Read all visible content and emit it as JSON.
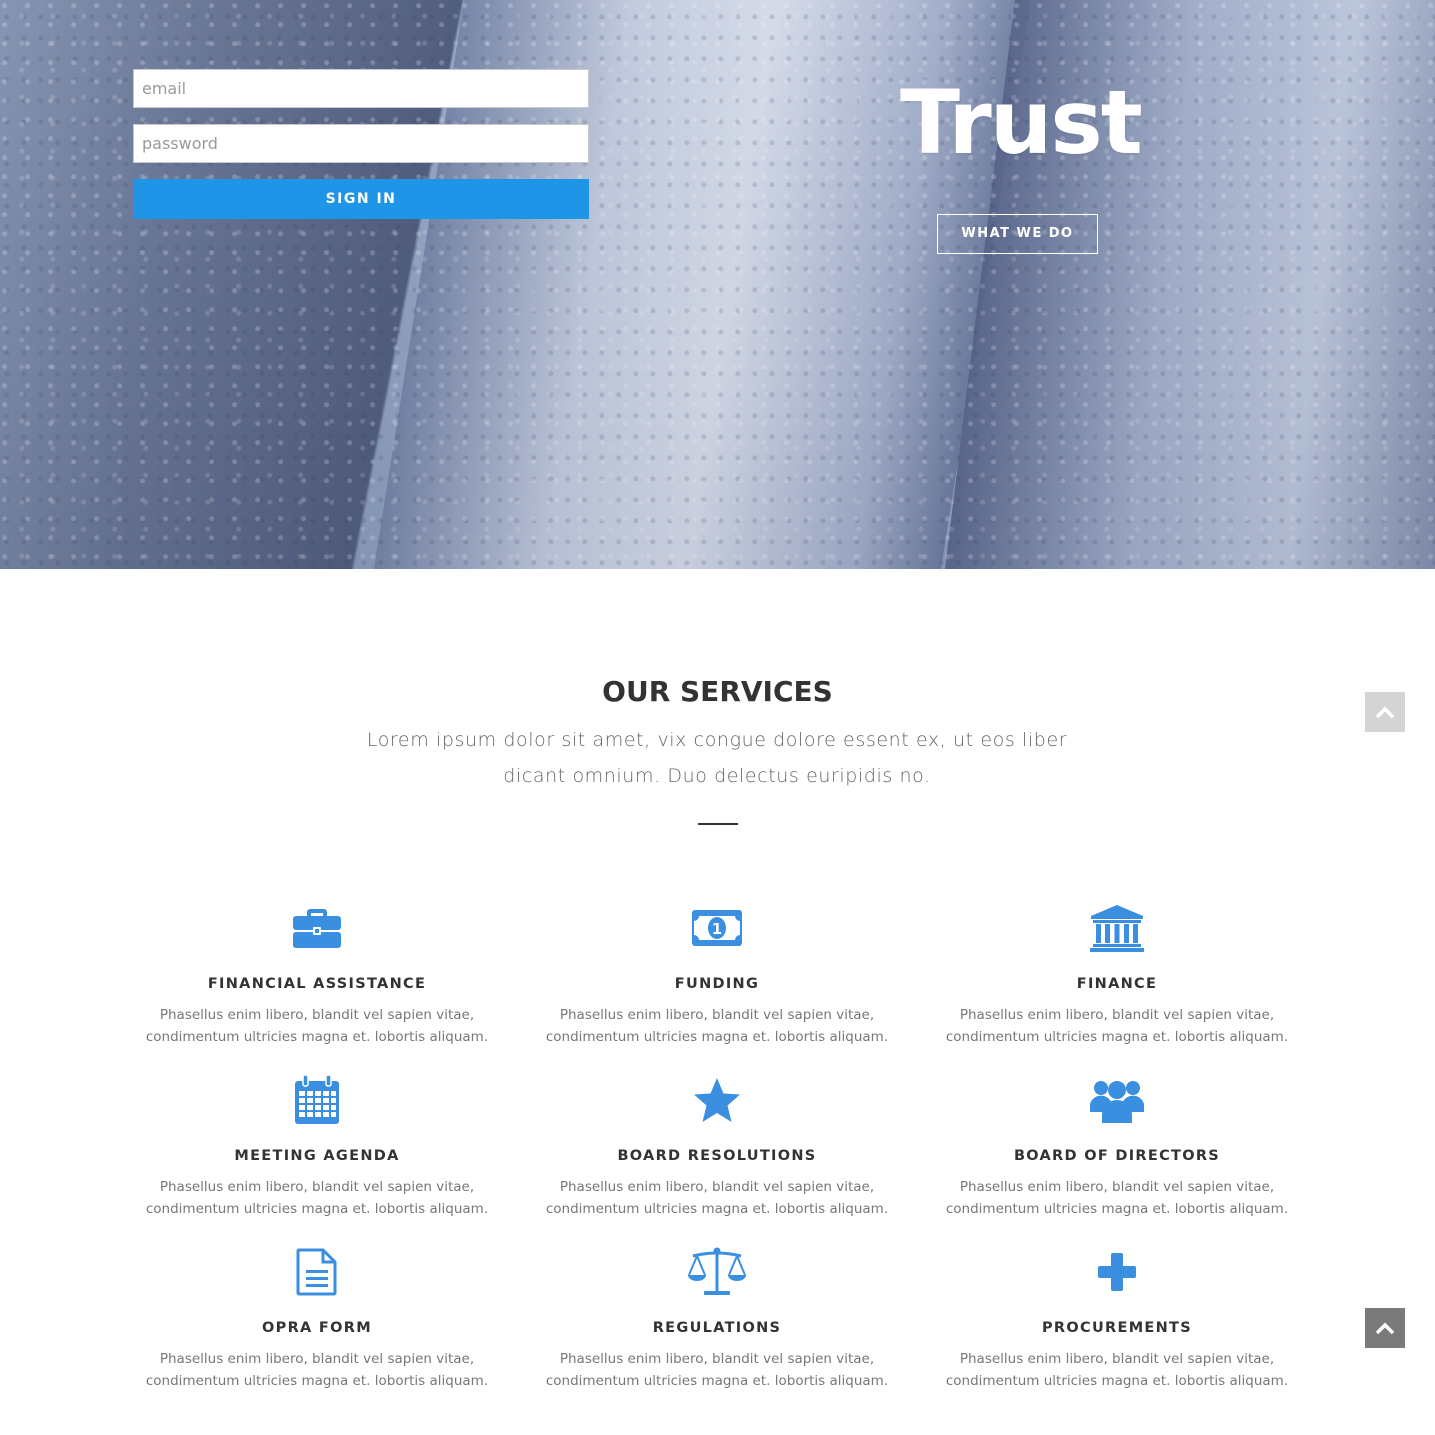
{
  "hero": {
    "email_placeholder": "email",
    "password_placeholder": "password",
    "signin_label": "SIGN IN",
    "title": "Trust",
    "cta_label": "WHAT WE DO"
  },
  "services": {
    "title": "OUR SERVICES",
    "intro": "Lorem ipsum dolor sit amet, vix congue dolore essent ex, ut eos liber dicant omnium. Duo delectus euripidis no.",
    "accent_color": "#3a8fe0",
    "items": [
      {
        "name": "FINANCIAL ASSISTANCE",
        "icon": "briefcase-icon",
        "desc": "Phasellus enim libero, blandit vel sapien vitae, condimentum ultricies magna et. lobortis aliquam."
      },
      {
        "name": "FUNDING",
        "icon": "money-icon",
        "desc": "Phasellus enim libero, blandit vel sapien vitae, condimentum ultricies magna et. lobortis aliquam."
      },
      {
        "name": "FINANCE",
        "icon": "bank-icon",
        "desc": "Phasellus enim libero, blandit vel sapien vitae, condimentum ultricies magna et. lobortis aliquam."
      },
      {
        "name": "MEETING AGENDA",
        "icon": "calendar-icon",
        "desc": "Phasellus enim libero, blandit vel sapien vitae, condimentum ultricies magna et. lobortis aliquam."
      },
      {
        "name": "BOARD RESOLUTIONS",
        "icon": "star-icon",
        "desc": "Phasellus enim libero, blandit vel sapien vitae, condimentum ultricies magna et. lobortis aliquam."
      },
      {
        "name": "BOARD OF DIRECTORS",
        "icon": "users-icon",
        "desc": "Phasellus enim libero, blandit vel sapien vitae, condimentum ultricies magna et. lobortis aliquam."
      },
      {
        "name": "OPRA FORM",
        "icon": "document-icon",
        "desc": "Phasellus enim libero, blandit vel sapien vitae, condimentum ultricies magna et. lobortis aliquam."
      },
      {
        "name": "REGULATIONS",
        "icon": "balance-scale-icon",
        "desc": "Phasellus enim libero, blandit vel sapien vitae, condimentum ultricies magna et. lobortis aliquam."
      },
      {
        "name": "PROCUREMENTS",
        "icon": "plus-icon",
        "desc": "Phasellus enim libero, blandit vel sapien vitae, condimentum ultricies magna et. lobortis aliquam."
      }
    ]
  },
  "back_to_top": {
    "icon": "chevron-up-icon"
  }
}
